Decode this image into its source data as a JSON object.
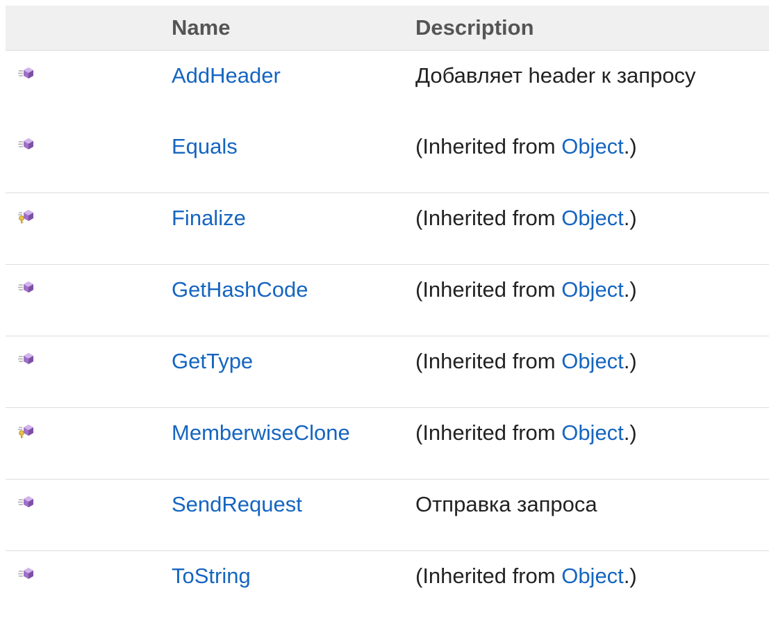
{
  "table": {
    "header": {
      "icon": "",
      "name": "Name",
      "description": "Description"
    },
    "rows": [
      {
        "icon": "public-method-icon",
        "name": "AddHeader",
        "description": "Добавляет header к запросу",
        "inherited": false
      },
      {
        "icon": "public-method-icon",
        "name": "Equals",
        "inherited": true,
        "desc_prefix": "(Inherited from ",
        "desc_link": "Object",
        "desc_suffix": ".)"
      },
      {
        "icon": "protected-method-icon",
        "name": "Finalize",
        "inherited": true,
        "desc_prefix": "(Inherited from ",
        "desc_link": "Object",
        "desc_suffix": ".)"
      },
      {
        "icon": "public-method-icon",
        "name": "GetHashCode",
        "inherited": true,
        "desc_prefix": "(Inherited from ",
        "desc_link": "Object",
        "desc_suffix": ".)"
      },
      {
        "icon": "public-method-icon",
        "name": "GetType",
        "inherited": true,
        "desc_prefix": "(Inherited from ",
        "desc_link": "Object",
        "desc_suffix": ".)"
      },
      {
        "icon": "protected-method-icon",
        "name": "MemberwiseClone",
        "inherited": true,
        "desc_prefix": "(Inherited from ",
        "desc_link": "Object",
        "desc_suffix": ".)"
      },
      {
        "icon": "public-method-icon",
        "name": "SendRequest",
        "description": "Отправка запроса",
        "inherited": false
      },
      {
        "icon": "public-method-icon",
        "name": "ToString",
        "inherited": true,
        "desc_prefix": "(Inherited from ",
        "desc_link": "Object",
        "desc_suffix": ".)"
      }
    ]
  },
  "colors": {
    "link": "#1565c0",
    "header_bg": "#f0f0f0",
    "header_text": "#555555",
    "icon_purple": "#9b59b6",
    "key_yellow": "#d4a017"
  }
}
